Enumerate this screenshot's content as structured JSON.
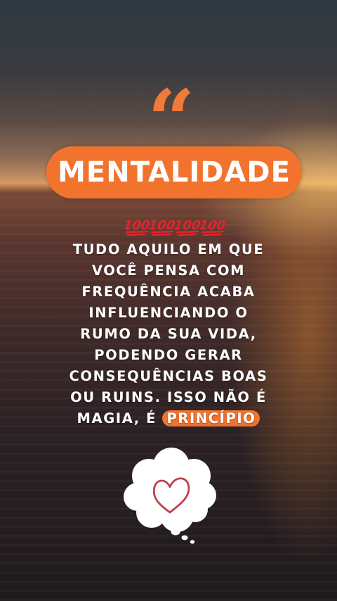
{
  "quote_mark": "“",
  "title": "MENTALIDADE",
  "hundreds": {
    "icon": "hundred-points-emoji",
    "count": 4,
    "label": "100"
  },
  "body": {
    "lines": [
      "TUDO AQUILO EM QUE",
      "VOCÊ PENSA COM",
      "FREQUÊNCIA ACABA",
      "INFLUENCIANDO O",
      "RUMO DA SUA VIDA,",
      "PODENDO GERAR",
      "CONSEQUÊNCIAS BOAS",
      "OU RUINS. ISSO NÃO É"
    ],
    "last_line_prefix": "MAGIA, É",
    "highlight_word": "PRINCÍPIO"
  },
  "sticker": {
    "icon": "thought-cloud-heart-icon"
  },
  "colors": {
    "accent": "#f2732e",
    "text": "#ffffff",
    "heart": "#c0404a"
  }
}
